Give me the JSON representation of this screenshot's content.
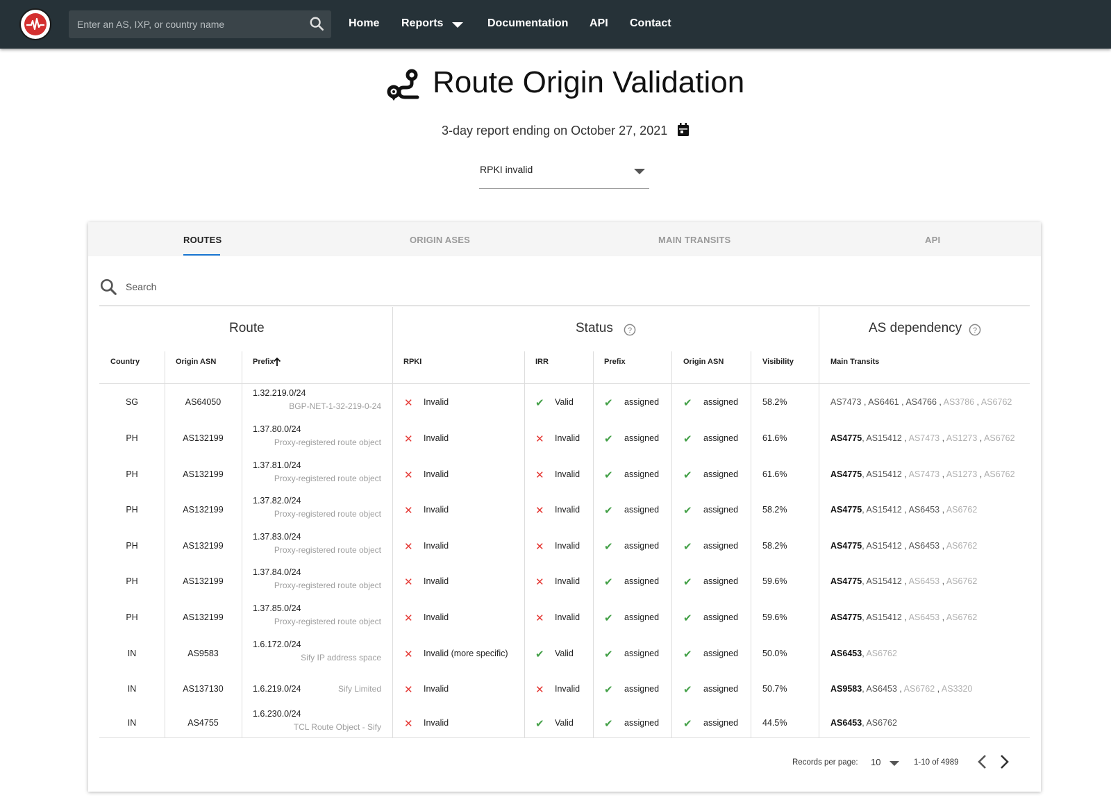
{
  "nav": {
    "search_placeholder": "Enter an AS, IXP, or country name",
    "links": [
      "Home",
      "Reports",
      "Documentation",
      "API",
      "Contact"
    ]
  },
  "header": {
    "title": "Route Origin Validation",
    "subtitle": "3-day report ending on October 27, 2021",
    "select_value": "RPKI invalid"
  },
  "tabs": [
    "ROUTES",
    "ORIGIN ASES",
    "MAIN TRANSITS",
    "API"
  ],
  "table": {
    "search_placeholder": "Search",
    "groups": [
      "Route",
      "Status",
      "AS dependency"
    ],
    "columns": [
      "Country",
      "Origin ASN",
      "Prefix",
      "RPKI",
      "IRR",
      "Prefix",
      "Origin ASN",
      "Visibility",
      "Main Transits"
    ],
    "rows": [
      {
        "country": "SG",
        "asn": "AS64050",
        "prefix": "1.32.219.0/24",
        "desc": "BGP-NET-1-32-219-0-24",
        "rpki": "Invalid",
        "irr": "Valid",
        "irr_ok": true,
        "pfx_status": "assigned",
        "asn_status": "assigned",
        "visibility": "58.2%",
        "transits": [
          {
            "t": "AS7473",
            "s": "norm"
          },
          {
            "t": "AS6461",
            "s": "norm"
          },
          {
            "t": "AS4766",
            "s": "norm"
          },
          {
            "t": "AS3786",
            "s": "light"
          },
          {
            "t": "AS6762",
            "s": "light"
          }
        ]
      },
      {
        "country": "PH",
        "asn": "AS132199",
        "prefix": "1.37.80.0/24",
        "desc": "Proxy-registered route object",
        "rpki": "Invalid",
        "irr": "Invalid",
        "irr_ok": false,
        "pfx_status": "assigned",
        "asn_status": "assigned",
        "visibility": "61.6%",
        "transits": [
          {
            "t": "AS4775",
            "s": "bold"
          },
          {
            "t": "AS15412",
            "s": "norm"
          },
          {
            "t": "AS7473",
            "s": "light"
          },
          {
            "t": "AS1273",
            "s": "light"
          },
          {
            "t": "AS6762",
            "s": "light"
          }
        ]
      },
      {
        "country": "PH",
        "asn": "AS132199",
        "prefix": "1.37.81.0/24",
        "desc": "Proxy-registered route object",
        "rpki": "Invalid",
        "irr": "Invalid",
        "irr_ok": false,
        "pfx_status": "assigned",
        "asn_status": "assigned",
        "visibility": "61.6%",
        "transits": [
          {
            "t": "AS4775",
            "s": "bold"
          },
          {
            "t": "AS15412",
            "s": "norm"
          },
          {
            "t": "AS7473",
            "s": "light"
          },
          {
            "t": "AS1273",
            "s": "light"
          },
          {
            "t": "AS6762",
            "s": "light"
          }
        ]
      },
      {
        "country": "PH",
        "asn": "AS132199",
        "prefix": "1.37.82.0/24",
        "desc": "Proxy-registered route object",
        "rpki": "Invalid",
        "irr": "Invalid",
        "irr_ok": false,
        "pfx_status": "assigned",
        "asn_status": "assigned",
        "visibility": "58.2%",
        "transits": [
          {
            "t": "AS4775",
            "s": "bold"
          },
          {
            "t": "AS15412",
            "s": "norm"
          },
          {
            "t": "AS6453",
            "s": "norm"
          },
          {
            "t": "AS6762",
            "s": "light"
          }
        ]
      },
      {
        "country": "PH",
        "asn": "AS132199",
        "prefix": "1.37.83.0/24",
        "desc": "Proxy-registered route object",
        "rpki": "Invalid",
        "irr": "Invalid",
        "irr_ok": false,
        "pfx_status": "assigned",
        "asn_status": "assigned",
        "visibility": "58.2%",
        "transits": [
          {
            "t": "AS4775",
            "s": "bold"
          },
          {
            "t": "AS15412",
            "s": "norm"
          },
          {
            "t": "AS6453",
            "s": "norm"
          },
          {
            "t": "AS6762",
            "s": "light"
          }
        ]
      },
      {
        "country": "PH",
        "asn": "AS132199",
        "prefix": "1.37.84.0/24",
        "desc": "Proxy-registered route object",
        "rpki": "Invalid",
        "irr": "Invalid",
        "irr_ok": false,
        "pfx_status": "assigned",
        "asn_status": "assigned",
        "visibility": "59.6%",
        "transits": [
          {
            "t": "AS4775",
            "s": "bold"
          },
          {
            "t": "AS15412",
            "s": "norm"
          },
          {
            "t": "AS6453",
            "s": "light"
          },
          {
            "t": "AS6762",
            "s": "light"
          }
        ]
      },
      {
        "country": "PH",
        "asn": "AS132199",
        "prefix": "1.37.85.0/24",
        "desc": "Proxy-registered route object",
        "rpki": "Invalid",
        "irr": "Invalid",
        "irr_ok": false,
        "pfx_status": "assigned",
        "asn_status": "assigned",
        "visibility": "59.6%",
        "transits": [
          {
            "t": "AS4775",
            "s": "bold"
          },
          {
            "t": "AS15412",
            "s": "norm"
          },
          {
            "t": "AS6453",
            "s": "light"
          },
          {
            "t": "AS6762",
            "s": "light"
          }
        ]
      },
      {
        "country": "IN",
        "asn": "AS9583",
        "prefix": "1.6.172.0/24",
        "desc": "Sify IP address space",
        "rpki": "Invalid (more specific)",
        "irr": "Valid",
        "irr_ok": true,
        "pfx_status": "assigned",
        "asn_status": "assigned",
        "visibility": "50.0%",
        "transits": [
          {
            "t": "AS6453",
            "s": "bold"
          },
          {
            "t": "AS6762",
            "s": "light"
          }
        ]
      },
      {
        "country": "IN",
        "asn": "AS137130",
        "prefix": "1.6.219.0/24",
        "desc": "Sify Limited",
        "inline_desc": true,
        "rpki": "Invalid",
        "irr": "Invalid",
        "irr_ok": false,
        "pfx_status": "assigned",
        "asn_status": "assigned",
        "visibility": "50.7%",
        "transits": [
          {
            "t": "AS9583",
            "s": "bold"
          },
          {
            "t": "AS6453",
            "s": "norm"
          },
          {
            "t": "AS6762",
            "s": "light"
          },
          {
            "t": "AS3320",
            "s": "light"
          }
        ]
      },
      {
        "country": "IN",
        "asn": "AS4755",
        "prefix": "1.6.230.0/24",
        "desc": "TCL Route Object - Sify",
        "rpki": "Invalid",
        "irr": "Valid",
        "irr_ok": true,
        "pfx_status": "assigned",
        "asn_status": "assigned",
        "visibility": "44.5%",
        "transits": [
          {
            "t": "AS6453",
            "s": "bold"
          },
          {
            "t": "AS6762",
            "s": "norm"
          }
        ]
      }
    ]
  },
  "pagination": {
    "records_label": "Records per page:",
    "per_page": "10",
    "range": "1-10 of 4989"
  },
  "colors": {
    "navbar": "#263238",
    "accent": "#1976d2",
    "invalid": "#e53935",
    "valid": "#43a047"
  },
  "icons": [
    "logo-icon",
    "search-icon",
    "chevron-down-icon",
    "route-icon",
    "calendar-icon",
    "help-icon",
    "arrow-up-icon",
    "check-icon",
    "cross-icon",
    "chevron-left-icon",
    "chevron-right-icon"
  ]
}
